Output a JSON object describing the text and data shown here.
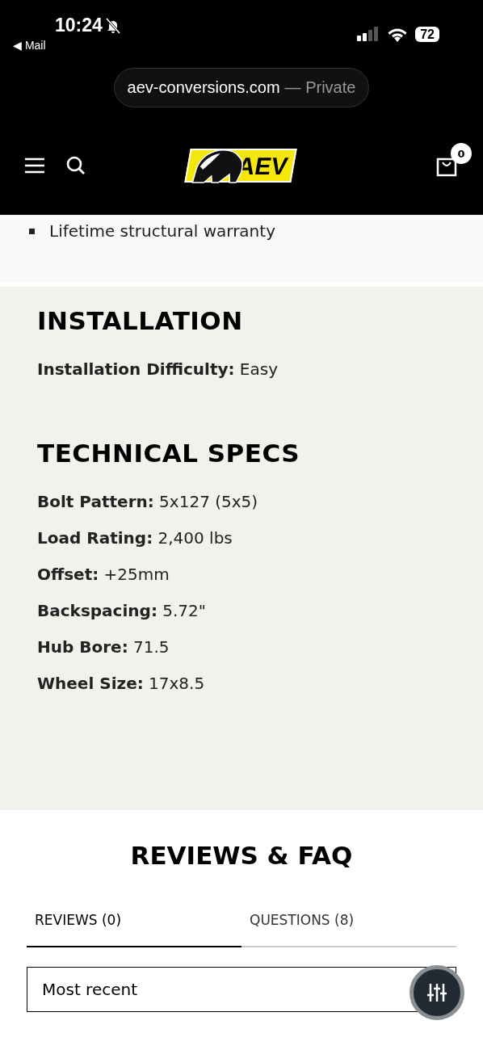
{
  "status_bar": {
    "time": "10:24",
    "back_link": "◀ Mail",
    "battery": "72"
  },
  "address_bar": {
    "domain": "aev-conversions.com",
    "mode": "— Private"
  },
  "header": {
    "logo_text": "AEV",
    "cart_count": "0"
  },
  "features": [
    "Lifetime structural warranty"
  ],
  "sections": [
    {
      "title": "INSTALLATION",
      "specs": [
        {
          "label": "Installation Difficulty:",
          "value": "Easy"
        }
      ]
    },
    {
      "title": "TECHNICAL SPECS",
      "specs": [
        {
          "label": "Bolt Pattern:",
          "value": "5x127 (5x5)"
        },
        {
          "label": "Load Rating:",
          "value": "2,400 lbs"
        },
        {
          "label": "Offset:",
          "value": "+25mm"
        },
        {
          "label": "Backspacing:",
          "value": "5.72\""
        },
        {
          "label": "Hub Bore:",
          "value": "71.5"
        },
        {
          "label": "Wheel Size:",
          "value": "17x8.5"
        }
      ]
    }
  ],
  "reviews": {
    "title": "REVIEWS & FAQ",
    "tabs": [
      {
        "label": "REVIEWS (0)",
        "selected": true
      },
      {
        "label": "QUESTIONS (8)",
        "selected": false
      }
    ],
    "sort": {
      "value": "Most recent"
    }
  }
}
